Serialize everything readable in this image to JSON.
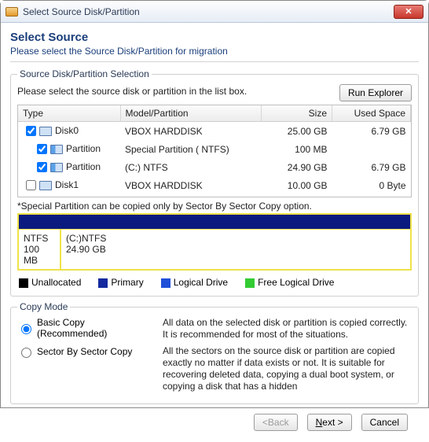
{
  "window_title": "Select Source Disk/Partition",
  "header": {
    "title": "Select Source",
    "subtitle": "Please select the Source Disk/Partition for migration"
  },
  "selection": {
    "legend": "Source Disk/Partition Selection",
    "instruction": "Please select the source disk or partition in the list box.",
    "run_explorer": "Run Explorer",
    "columns": {
      "type": "Type",
      "model": "Model/Partition",
      "size": "Size",
      "used": "Used Space"
    },
    "rows": [
      {
        "checked": true,
        "icon": "disk",
        "indent": 0,
        "type": "Disk0",
        "model": "VBOX HARDDISK",
        "size": "25.00 GB",
        "used": "6.79 GB"
      },
      {
        "checked": true,
        "icon": "part",
        "indent": 1,
        "type": "Partition",
        "model": "Special Partition ( NTFS)",
        "size": "100 MB",
        "used": ""
      },
      {
        "checked": true,
        "icon": "part",
        "indent": 1,
        "type": "Partition",
        "model": "(C:)  NTFS",
        "size": "24.90 GB",
        "used": "6.79 GB"
      },
      {
        "checked": false,
        "icon": "disk",
        "indent": 0,
        "type": "Disk1",
        "model": "VBOX HARDDISK",
        "size": "10.00 GB",
        "used": "0 Byte"
      }
    ],
    "note": "*Special Partition can be copied only by Sector By Sector Copy option."
  },
  "viz": {
    "cell1_line1": "NTFS",
    "cell1_line2": "100 MB",
    "cell2_line1": "(C:)NTFS",
    "cell2_line2": "24.90 GB"
  },
  "legend": {
    "unalloc": "Unallocated",
    "primary": "Primary",
    "logical": "Logical Drive",
    "freelogical": "Free Logical Drive"
  },
  "copymode": {
    "legend": "Copy Mode",
    "basic_label": "Basic Copy (Recommended)",
    "basic_desc": "All data on the selected disk or partition is copied correctly. It is recommended for most of the situations.",
    "sector_label": "Sector By Sector Copy",
    "sector_desc": "All the sectors on the source disk or partition are copied exactly no matter if data exists or not. It is suitable for recovering deleted data, copying a dual boot system, or copying a disk that has a hidden"
  },
  "footer": {
    "back": "<Back",
    "next": "Next >",
    "cancel": "Cancel"
  }
}
